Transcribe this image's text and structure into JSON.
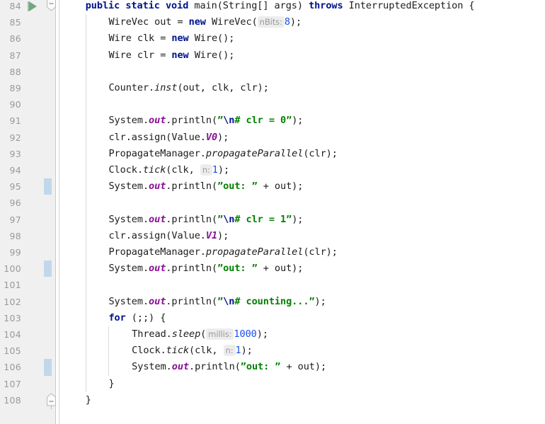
{
  "editor": {
    "first_line": 84,
    "last_line": 108,
    "line_height": 23.2,
    "colors": {
      "gutter_bg": "#f0f0f0",
      "editor_bg": "#ffffff",
      "lineno": "#999999",
      "keyword": "#00128c",
      "string": "#008000",
      "number": "#1750eb",
      "static_field": "#871094",
      "hint_bg": "#ededed",
      "hint_text": "#999999",
      "change_bar": "#c2d7ea",
      "run_icon": "#71a77d",
      "indent_guide": "#d8d8d8"
    }
  },
  "gutter": {
    "run_icon_name": "run-triangle-icon",
    "run_icon_line": 84,
    "fold_markers": [
      {
        "line": 84,
        "type": "fold-open-top",
        "glyph": "−"
      },
      {
        "line": 108,
        "type": "fold-open-bottom",
        "glyph": "−"
      }
    ],
    "change_bar_lines": [
      95,
      100,
      106
    ]
  },
  "lines": [
    {
      "n": 84,
      "indent": 4,
      "tokens": [
        {
          "t": "kw",
          "s": "public"
        },
        {
          "t": "plain",
          "s": " "
        },
        {
          "t": "kw",
          "s": "static"
        },
        {
          "t": "plain",
          "s": " "
        },
        {
          "t": "kw",
          "s": "void"
        },
        {
          "t": "plain",
          "s": " main(String[] args) "
        },
        {
          "t": "kw",
          "s": "throws"
        },
        {
          "t": "plain",
          "s": " InterruptedException {"
        }
      ]
    },
    {
      "n": 85,
      "indent": 8,
      "tokens": [
        {
          "t": "plain",
          "s": "WireVec out = "
        },
        {
          "t": "kw",
          "s": "new"
        },
        {
          "t": "plain",
          "s": " WireVec("
        },
        {
          "t": "hint",
          "s": "nBits:"
        },
        {
          "t": "num",
          "s": "8"
        },
        {
          "t": "plain",
          "s": ");"
        }
      ]
    },
    {
      "n": 86,
      "indent": 8,
      "tokens": [
        {
          "t": "plain",
          "s": "Wire clk = "
        },
        {
          "t": "kw",
          "s": "new"
        },
        {
          "t": "plain",
          "s": " Wire();"
        }
      ]
    },
    {
      "n": 87,
      "indent": 8,
      "tokens": [
        {
          "t": "plain",
          "s": "Wire clr = "
        },
        {
          "t": "kw",
          "s": "new"
        },
        {
          "t": "plain",
          "s": " Wire();"
        }
      ]
    },
    {
      "n": 88,
      "indent": 0,
      "tokens": []
    },
    {
      "n": 89,
      "indent": 8,
      "tokens": [
        {
          "t": "plain",
          "s": "Counter."
        },
        {
          "t": "statmeth",
          "s": "inst"
        },
        {
          "t": "plain",
          "s": "(out, clk, clr);"
        }
      ]
    },
    {
      "n": 90,
      "indent": 0,
      "tokens": []
    },
    {
      "n": 91,
      "indent": 8,
      "tokens": [
        {
          "t": "plain",
          "s": "System."
        },
        {
          "t": "statfld",
          "s": "out"
        },
        {
          "t": "plain",
          "s": ".println("
        },
        {
          "t": "str",
          "s": "”"
        },
        {
          "t": "esc",
          "s": "\\n"
        },
        {
          "t": "str",
          "s": "# clr = 0"
        },
        {
          "t": "str",
          "s": "”"
        },
        {
          "t": "plain",
          "s": ");"
        }
      ]
    },
    {
      "n": 92,
      "indent": 8,
      "tokens": [
        {
          "t": "plain",
          "s": "clr.assign(Value."
        },
        {
          "t": "enumc",
          "s": "V0"
        },
        {
          "t": "plain",
          "s": ");"
        }
      ]
    },
    {
      "n": 93,
      "indent": 8,
      "tokens": [
        {
          "t": "plain",
          "s": "PropagateManager."
        },
        {
          "t": "statmeth",
          "s": "propagateParallel"
        },
        {
          "t": "plain",
          "s": "(clr);"
        }
      ]
    },
    {
      "n": 94,
      "indent": 8,
      "tokens": [
        {
          "t": "plain",
          "s": "Clock."
        },
        {
          "t": "statmeth",
          "s": "tick"
        },
        {
          "t": "plain",
          "s": "(clk, "
        },
        {
          "t": "hint",
          "s": "n:"
        },
        {
          "t": "num",
          "s": "1"
        },
        {
          "t": "plain",
          "s": ");"
        }
      ]
    },
    {
      "n": 95,
      "indent": 8,
      "tokens": [
        {
          "t": "plain",
          "s": "System."
        },
        {
          "t": "statfld",
          "s": "out"
        },
        {
          "t": "plain",
          "s": ".println("
        },
        {
          "t": "str",
          "s": "”out: ”"
        },
        {
          "t": "plain",
          "s": " + out);"
        }
      ]
    },
    {
      "n": 96,
      "indent": 0,
      "tokens": []
    },
    {
      "n": 97,
      "indent": 8,
      "tokens": [
        {
          "t": "plain",
          "s": "System."
        },
        {
          "t": "statfld",
          "s": "out"
        },
        {
          "t": "plain",
          "s": ".println("
        },
        {
          "t": "str",
          "s": "”"
        },
        {
          "t": "esc",
          "s": "\\n"
        },
        {
          "t": "str",
          "s": "# clr = 1"
        },
        {
          "t": "str",
          "s": "”"
        },
        {
          "t": "plain",
          "s": ");"
        }
      ]
    },
    {
      "n": 98,
      "indent": 8,
      "tokens": [
        {
          "t": "plain",
          "s": "clr.assign(Value."
        },
        {
          "t": "enumc",
          "s": "V1"
        },
        {
          "t": "plain",
          "s": ");"
        }
      ]
    },
    {
      "n": 99,
      "indent": 8,
      "tokens": [
        {
          "t": "plain",
          "s": "PropagateManager."
        },
        {
          "t": "statmeth",
          "s": "propagateParallel"
        },
        {
          "t": "plain",
          "s": "(clr);"
        }
      ]
    },
    {
      "n": 100,
      "indent": 8,
      "tokens": [
        {
          "t": "plain",
          "s": "System."
        },
        {
          "t": "statfld",
          "s": "out"
        },
        {
          "t": "plain",
          "s": ".println("
        },
        {
          "t": "str",
          "s": "”out: ”"
        },
        {
          "t": "plain",
          "s": " + out);"
        }
      ]
    },
    {
      "n": 101,
      "indent": 0,
      "tokens": []
    },
    {
      "n": 102,
      "indent": 8,
      "tokens": [
        {
          "t": "plain",
          "s": "System."
        },
        {
          "t": "statfld",
          "s": "out"
        },
        {
          "t": "plain",
          "s": ".println("
        },
        {
          "t": "str",
          "s": "”"
        },
        {
          "t": "esc",
          "s": "\\n"
        },
        {
          "t": "str",
          "s": "# counting..."
        },
        {
          "t": "str",
          "s": "”"
        },
        {
          "t": "plain",
          "s": ");"
        }
      ]
    },
    {
      "n": 103,
      "indent": 8,
      "tokens": [
        {
          "t": "kw",
          "s": "for"
        },
        {
          "t": "plain",
          "s": " (;;) {"
        }
      ]
    },
    {
      "n": 104,
      "indent": 12,
      "tokens": [
        {
          "t": "plain",
          "s": "Thread."
        },
        {
          "t": "statmeth",
          "s": "sleep"
        },
        {
          "t": "plain",
          "s": "("
        },
        {
          "t": "hint",
          "s": "millis:"
        },
        {
          "t": "num",
          "s": "1000"
        },
        {
          "t": "plain",
          "s": ");"
        }
      ]
    },
    {
      "n": 105,
      "indent": 12,
      "tokens": [
        {
          "t": "plain",
          "s": "Clock."
        },
        {
          "t": "statmeth",
          "s": "tick"
        },
        {
          "t": "plain",
          "s": "(clk, "
        },
        {
          "t": "hint",
          "s": "n:"
        },
        {
          "t": "num",
          "s": "1"
        },
        {
          "t": "plain",
          "s": ");"
        }
      ]
    },
    {
      "n": 106,
      "indent": 12,
      "tokens": [
        {
          "t": "plain",
          "s": "System."
        },
        {
          "t": "statfld",
          "s": "out"
        },
        {
          "t": "plain",
          "s": ".println("
        },
        {
          "t": "str",
          "s": "”out: ”"
        },
        {
          "t": "plain",
          "s": " + out);"
        }
      ]
    },
    {
      "n": 107,
      "indent": 8,
      "tokens": [
        {
          "t": "plain",
          "s": "}"
        }
      ]
    },
    {
      "n": 108,
      "indent": 4,
      "tokens": [
        {
          "t": "plain",
          "s": "}"
        }
      ]
    }
  ],
  "indent_guides": [
    {
      "col": 4,
      "from_line": 85,
      "to_line": 107
    },
    {
      "col": 8,
      "from_line": 104,
      "to_line": 106
    }
  ]
}
